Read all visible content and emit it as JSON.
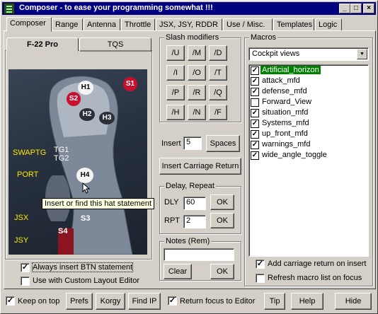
{
  "window": {
    "title": "Composer - to ease your programming somewhat !!!",
    "buttons": {
      "minimize": "_",
      "maximize": "□",
      "close": "×"
    }
  },
  "tabs": [
    {
      "label": "Composer"
    },
    {
      "label": "Range"
    },
    {
      "label": "Antenna"
    },
    {
      "label": "Throttle"
    },
    {
      "label": "JSX, JSY, RDDR"
    },
    {
      "label": "Use / Misc."
    },
    {
      "label": "Templates"
    },
    {
      "label": "Logic"
    }
  ],
  "stick_panel": {
    "tabs": [
      "F-22 Pro",
      "TQS"
    ],
    "hotspots": [
      "H1",
      "S1",
      "S2",
      "H2",
      "H3",
      "TG1",
      "TG2",
      "H4",
      "S3",
      "S4"
    ],
    "labels": [
      "SWAPTG",
      "PORT",
      "JSX",
      "JSY"
    ],
    "tooltip": "Insert or find this hat statement",
    "always_insert_btn": "Always insert BTN statement",
    "use_custom_layout": "Use with Custom Layout Editor"
  },
  "slash_modifiers": {
    "title": "Slash modifiers",
    "buttons": [
      "/U",
      "/M",
      "/D",
      "/I",
      "/O",
      "/T",
      "/P",
      "/R",
      "/Q",
      "/H",
      "/N",
      "/F"
    ]
  },
  "insert": {
    "label": "Insert",
    "value": "5",
    "spaces_button": "Spaces",
    "carriage_return_button": "Insert Carriage Return"
  },
  "delay_repeat": {
    "title": "Delay, Repeat",
    "dly_label": "DLY",
    "dly_value": "60",
    "rpt_label": "RPT",
    "rpt_value": "2",
    "ok_label": "OK"
  },
  "notes": {
    "title": "Notes  (Rem)",
    "value": "",
    "clear_button": "Clear",
    "ok_button": "OK"
  },
  "macros": {
    "title": "Macros",
    "selected_category": "Cockpit views",
    "items": [
      {
        "label": "Artificial_horizon",
        "checked": true,
        "selected": true
      },
      {
        "label": "attack_mfd",
        "checked": true,
        "selected": false
      },
      {
        "label": "defense_mfd",
        "checked": true,
        "selected": false
      },
      {
        "label": "Forward_View",
        "checked": false,
        "selected": false
      },
      {
        "label": "situation_mfd",
        "checked": true,
        "selected": false
      },
      {
        "label": "Systems_mfd",
        "checked": true,
        "selected": false
      },
      {
        "label": "up_front_mfd",
        "checked": true,
        "selected": false
      },
      {
        "label": "warnings_mfd",
        "checked": true,
        "selected": false
      },
      {
        "label": "wide_angle_toggle",
        "checked": true,
        "selected": false
      }
    ],
    "add_cr_label": "Add carriage return on insert",
    "add_cr_checked": true,
    "refresh_label": "Refresh macro list on focus",
    "refresh_checked": false
  },
  "bottom": {
    "keep_on_top": "Keep on top",
    "keep_on_top_checked": true,
    "prefs": "Prefs",
    "korgy": "Korgy",
    "find_ip": "Find IP",
    "return_focus": "Return focus to Editor",
    "return_focus_checked": true,
    "tip": "Tip",
    "help": "Help",
    "hide": "Hide"
  },
  "colors": {
    "window_bg": "#d4d0c8",
    "title_bg": "#000080",
    "selection": "#008000",
    "label_yellow": "#ffea00",
    "hotspot_red": "#c8102e"
  }
}
